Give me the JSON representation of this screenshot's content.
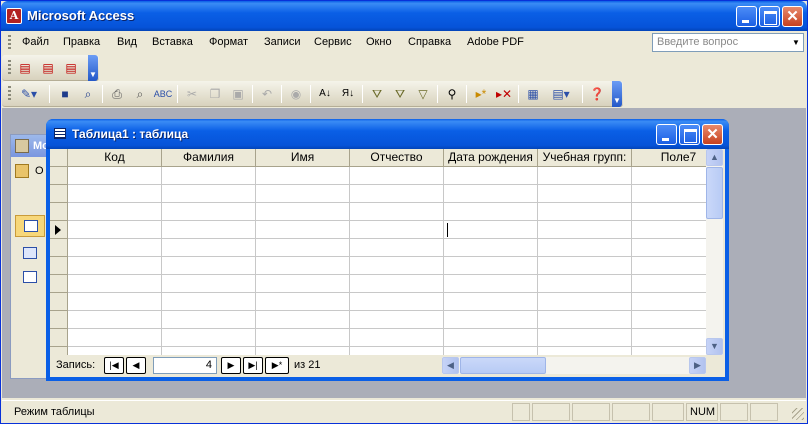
{
  "app": {
    "title": "Microsoft Access",
    "icon_letter": "A"
  },
  "menu": {
    "items": [
      "Файл",
      "Правка",
      "Вид",
      "Вставка",
      "Формат",
      "Записи",
      "Сервис",
      "Окно",
      "Справка",
      "Adobe PDF"
    ],
    "help_placeholder": "Введите вопрос"
  },
  "toolbar_pdf": {
    "icons": [
      "pdf-convert-icon",
      "pdf-email-icon",
      "pdf-review-icon"
    ]
  },
  "toolbar_main": {
    "icons": [
      "view-icon",
      "save-icon",
      "search-db-icon",
      "print-icon",
      "print-preview-icon",
      "spelling-icon",
      "cut-icon",
      "copy-icon",
      "paste-icon",
      "undo-icon",
      "hyperlink-icon",
      "sort-asc-icon",
      "sort-desc-icon",
      "filter-selection-icon",
      "filter-form-icon",
      "apply-filter-icon",
      "find-icon",
      "new-record-icon",
      "delete-record-icon",
      "database-window-icon",
      "new-object-icon",
      "help-icon"
    ]
  },
  "db_window": {
    "title": "Mo",
    "toolbar_label": "O"
  },
  "table_window": {
    "title": "Таблица1 : таблица",
    "columns": [
      "Код",
      "Фамилия",
      "Имя",
      "Отчество",
      "Дата рождения",
      "Учебная групп:",
      "Поле7"
    ],
    "row_count": 11,
    "current_row": 3
  },
  "record_nav": {
    "label": "Запись:",
    "current": "4",
    "of_label": "из",
    "total": "21"
  },
  "status": {
    "mode": "Режим таблицы",
    "num": "NUM"
  },
  "colors": {
    "titlebar": "#0a5fe6",
    "workspace": "#abaeb8",
    "chrome": "#ece9d8"
  }
}
